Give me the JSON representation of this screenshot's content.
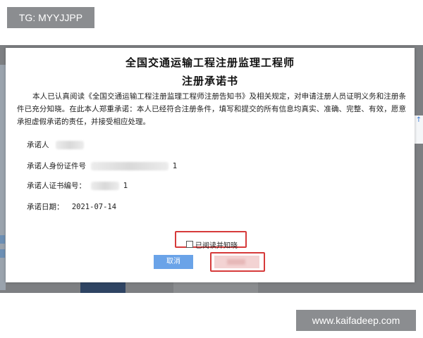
{
  "watermarks": {
    "top_left": "TG: MYYJJPP",
    "bottom_right": "www.kaifadeep.com"
  },
  "background": {
    "right_tab_glyph": "↑"
  },
  "dialog": {
    "title_line1": "全国交通运输工程注册监理工程师",
    "title_line2": "注册承诺书",
    "statement": "本人已认真阅读《全国交通运输工程注册监理工程师注册告知书》及相关规定，对申请注册人员证明义务和注册条件已充分知晓。在此本人郑重承诺：本人已经符合注册条件，填写和提交的所有信息均真实、准确、完整、有效，愿意承担虚假承诺的责任，并接受相应处理。",
    "fields": {
      "promisor_label": "承诺人",
      "id_number_label": "承诺人身份证件号",
      "id_number_tail": "1",
      "certificate_label": "承诺人证书编号：",
      "certificate_tail": "1",
      "date_label": "承诺日期：",
      "date_value": "2021-07-14"
    },
    "agree_checkbox_label": "已阅读并知晓",
    "cancel_button": "取消"
  },
  "colors": {
    "highlight_border": "#d63a3a",
    "cancel_button_bg": "#6aa3e8",
    "confirm_button_bg": "#f3d3d3",
    "overlay": "#7d7f82"
  }
}
